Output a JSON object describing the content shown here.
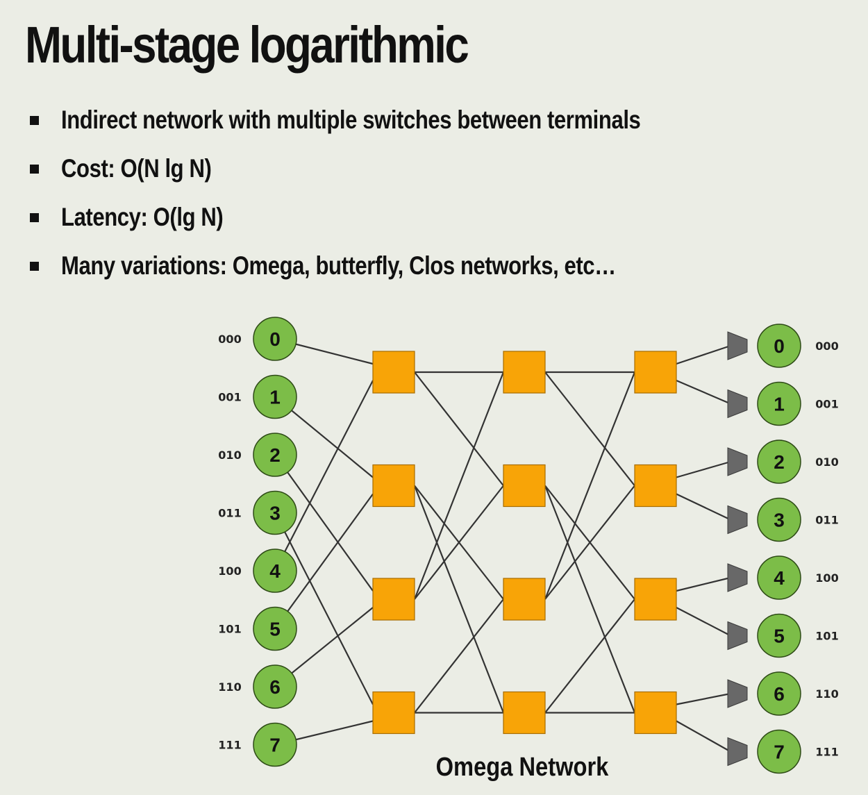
{
  "title": "Multi-stage logarithmic",
  "bullets": [
    "Indirect network with multiple switches between terminals",
    "Cost: O(N lg N)",
    "Latency: O(lg N)",
    "Many variations: Omega, butterfly, Clos networks, etc…"
  ],
  "diagram": {
    "caption": "Omega Network",
    "colors": {
      "terminal": "#7cbd48",
      "switch": "#f8a407",
      "receiver": "#686868",
      "line": "#333333"
    },
    "inputs": [
      {
        "label": "0",
        "binary": "000"
      },
      {
        "label": "1",
        "binary": "001"
      },
      {
        "label": "2",
        "binary": "010"
      },
      {
        "label": "3",
        "binary": "011"
      },
      {
        "label": "4",
        "binary": "100"
      },
      {
        "label": "5",
        "binary": "101"
      },
      {
        "label": "6",
        "binary": "110"
      },
      {
        "label": "7",
        "binary": "111"
      }
    ],
    "outputs": [
      {
        "label": "0",
        "binary": "000"
      },
      {
        "label": "1",
        "binary": "001"
      },
      {
        "label": "2",
        "binary": "010"
      },
      {
        "label": "3",
        "binary": "011"
      },
      {
        "label": "4",
        "binary": "100"
      },
      {
        "label": "5",
        "binary": "101"
      },
      {
        "label": "6",
        "binary": "110"
      },
      {
        "label": "7",
        "binary": "111"
      }
    ],
    "stages": 3,
    "switches_per_stage": 4
  }
}
